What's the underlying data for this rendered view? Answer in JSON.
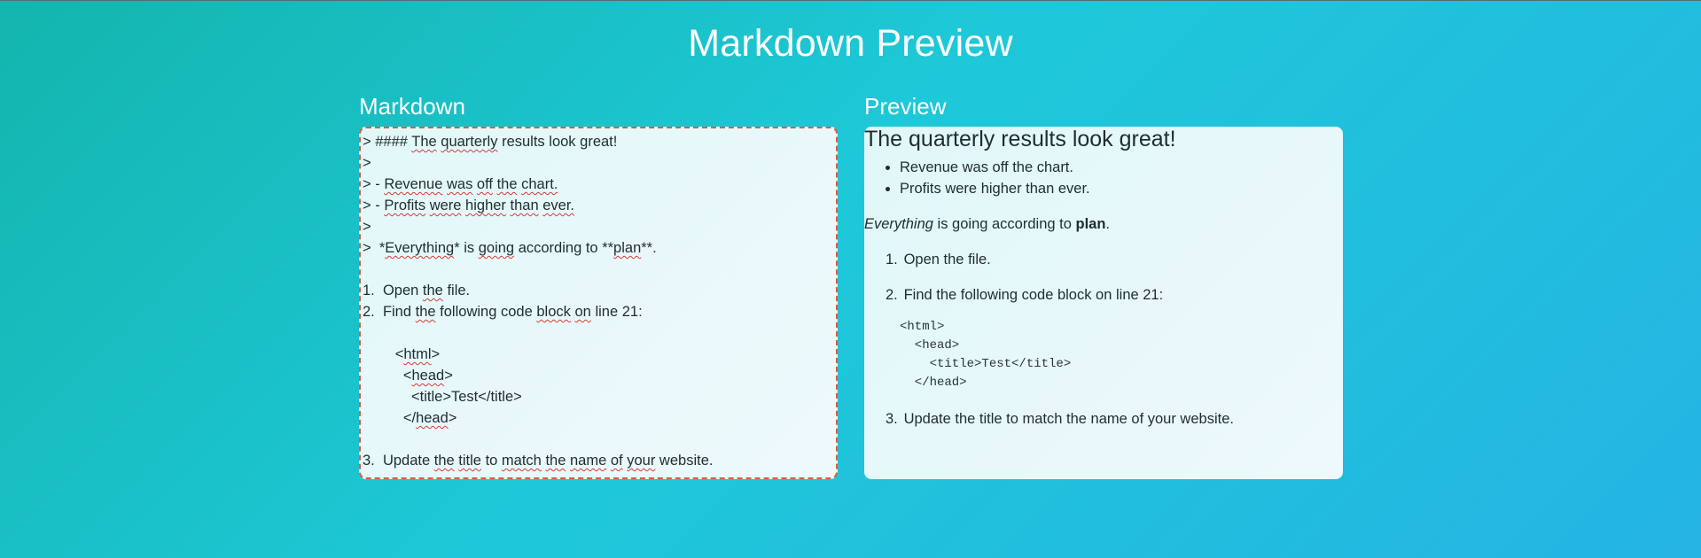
{
  "page": {
    "title": "Markdown Preview"
  },
  "editor": {
    "label": "Markdown",
    "lines": [
      "> #### The quarterly results look great!",
      ">",
      "> - Revenue was off the chart.",
      "> - Profits were higher than ever.",
      ">",
      ">  *Everything* is going according to **plan**.",
      "",
      "1.  Open the file.",
      "2.  Find the following code block on line 21:",
      "",
      "        <html>",
      "          <head>",
      "            <title>Test</title>",
      "          </head>",
      "",
      "3.  Update the title to match the name of your website."
    ]
  },
  "preview": {
    "label": "Preview",
    "heading": "The quarterly results look great!",
    "bullets": [
      "Revenue was off the chart.",
      "Profits were higher than ever."
    ],
    "paragraph": {
      "italic": "Everything",
      "middle": " is going according to ",
      "bold": "plan",
      "end": "."
    },
    "steps": [
      {
        "num": "1.",
        "text": "Open the file."
      },
      {
        "num": "2.",
        "text": "Find the following code block on line 21:"
      },
      {
        "num": "3.",
        "text": "Update the title to match the name of your website."
      }
    ],
    "code": "<html>\n  <head>\n    <title>Test</title>\n  </head>"
  }
}
